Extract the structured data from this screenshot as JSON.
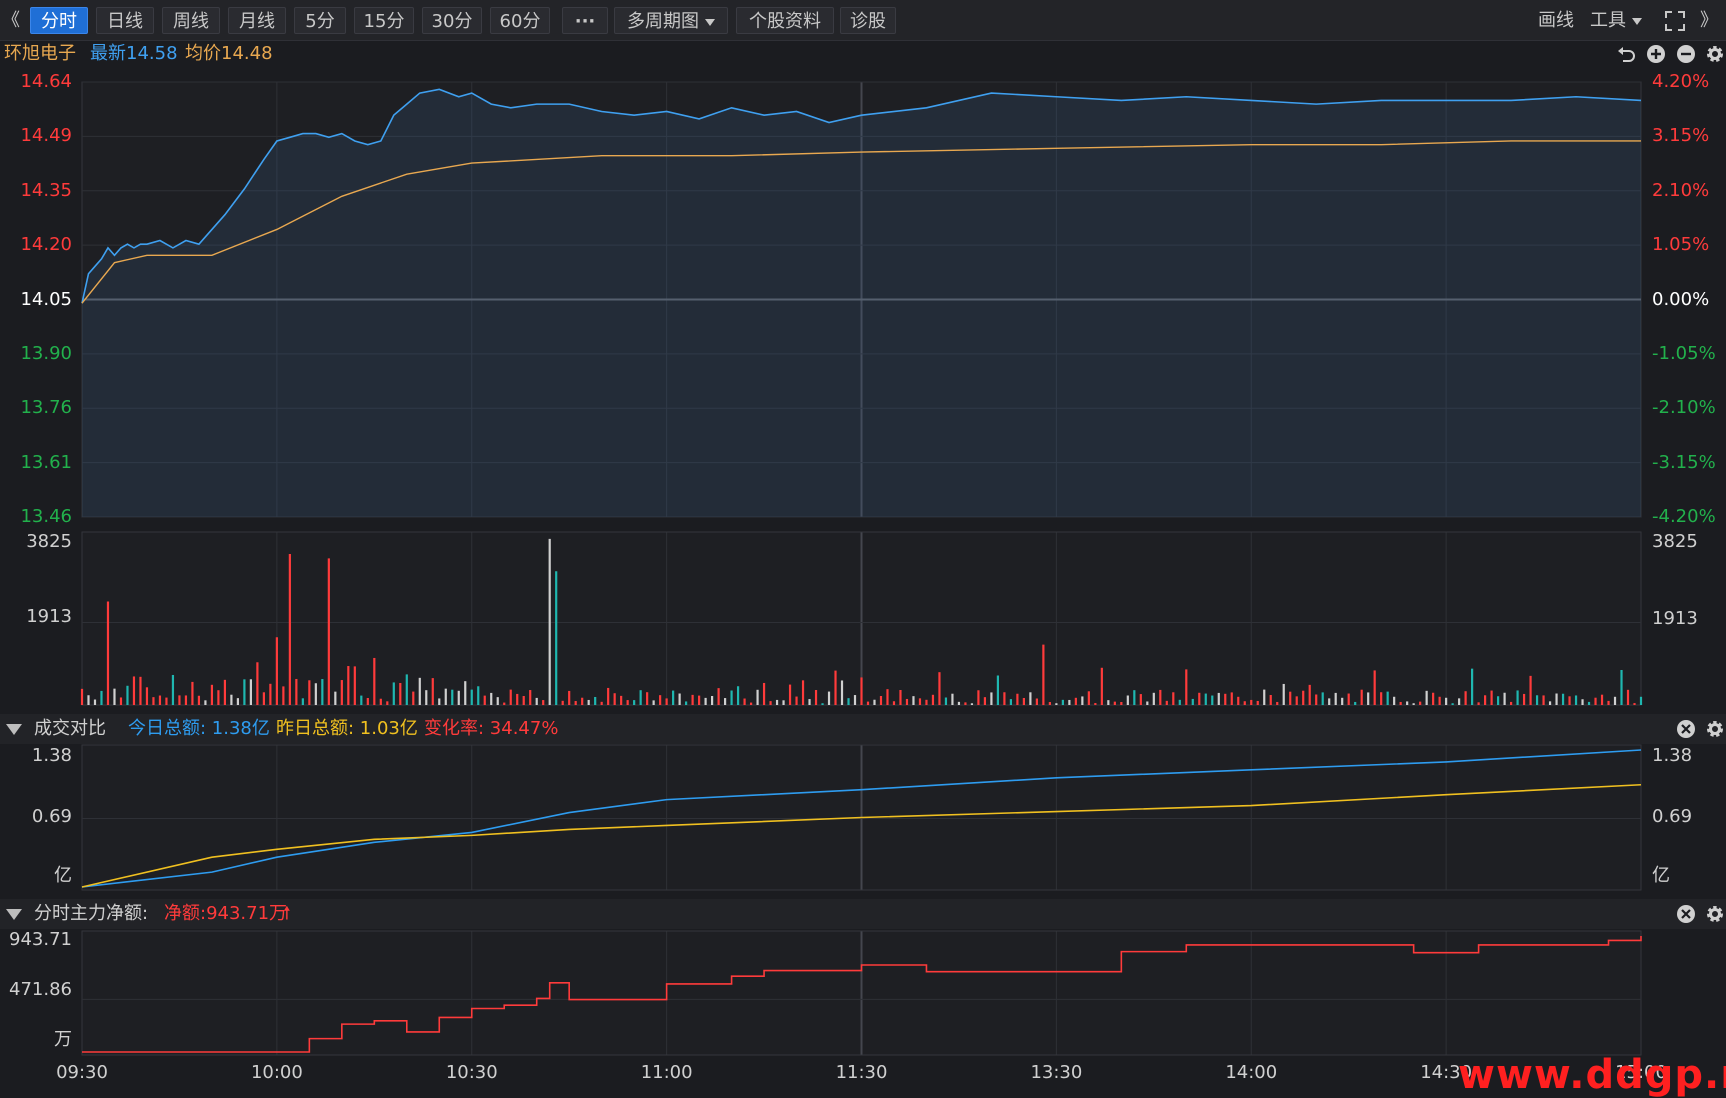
{
  "toolbar": {
    "nav_left": "《",
    "periods": [
      "分时",
      "日线",
      "周线",
      "月线",
      "5分",
      "15分",
      "30分",
      "60分"
    ],
    "more": "···",
    "multi": "多周期图",
    "profile": "个股资料",
    "diagnose": "诊股",
    "draw": "画线",
    "tools": "工具",
    "nav_right": "》"
  },
  "quote": {
    "name": "环旭电子",
    "latest": "最新14.58",
    "avg": "均价14.48"
  },
  "price_axis": {
    "left": [
      "14.64",
      "14.49",
      "14.35",
      "14.20",
      "14.05",
      "13.90",
      "13.76",
      "13.61",
      "13.46"
    ],
    "right": [
      "4.20%",
      "3.15%",
      "2.10%",
      "1.05%",
      "0.00%",
      "-1.05%",
      "-2.10%",
      "-3.15%",
      "-4.20%"
    ]
  },
  "volume_axis": {
    "left": [
      "3825",
      "1913"
    ],
    "right": [
      "3825",
      "1913"
    ]
  },
  "turnover_panel": {
    "title": "成交对比",
    "today": "今日总额: 1.38亿",
    "yesterday": "昨日总额: 1.03亿",
    "change": "变化率: 34.47%",
    "axis_left": [
      "1.38",
      "0.69",
      "亿"
    ],
    "axis_right": [
      "1.38",
      "0.69",
      "亿"
    ]
  },
  "netflow_panel": {
    "title": "分时主力净额:",
    "net": "净额:943.71万",
    "axis_left": [
      "943.71",
      "471.86",
      "万"
    ]
  },
  "time_axis": [
    "09:30",
    "10:00",
    "10:30",
    "11:00",
    "11:30",
    "13:30",
    "14:00",
    "14:30",
    "15:00"
  ],
  "watermark": "www.ddgp.net",
  "colors": {
    "price": "#3fa0f0",
    "avg": "#e8a850",
    "up": "#ff3b3b",
    "down": "#22b14c",
    "today": "#2e9cf0",
    "yesterday": "#f0c020",
    "net": "#ff3b3b"
  },
  "chart_data": [
    {
      "type": "line",
      "title": "",
      "series": [
        {
          "name": "最新",
          "x_minutes": [
            0,
            1,
            2,
            3,
            4,
            5,
            6,
            7,
            8,
            9,
            10,
            12,
            14,
            16,
            18,
            20,
            22,
            25,
            28,
            30,
            32,
            34,
            36,
            38,
            40,
            42,
            44,
            46,
            48,
            50,
            52,
            55,
            58,
            60,
            63,
            66,
            70,
            75,
            80,
            85,
            90,
            95,
            100,
            105,
            110,
            115,
            120,
            130,
            140,
            150,
            160,
            170,
            180,
            190,
            200,
            210,
            220,
            230,
            240
          ],
          "values": [
            14.04,
            14.12,
            14.14,
            14.16,
            14.19,
            14.17,
            14.19,
            14.2,
            14.19,
            14.2,
            14.2,
            14.21,
            14.19,
            14.21,
            14.2,
            14.24,
            14.28,
            14.35,
            14.43,
            14.48,
            14.49,
            14.5,
            14.5,
            14.49,
            14.5,
            14.48,
            14.47,
            14.48,
            14.55,
            14.58,
            14.61,
            14.62,
            14.6,
            14.61,
            14.58,
            14.57,
            14.58,
            14.58,
            14.56,
            14.55,
            14.56,
            14.54,
            14.57,
            14.55,
            14.56,
            14.53,
            14.55,
            14.57,
            14.61,
            14.6,
            14.59,
            14.6,
            14.59,
            14.58,
            14.59,
            14.59,
            14.59,
            14.6,
            14.59
          ]
        },
        {
          "name": "均价",
          "x_minutes": [
            0,
            5,
            10,
            20,
            30,
            40,
            50,
            60,
            80,
            100,
            120,
            150,
            180,
            200,
            220,
            240
          ],
          "values": [
            14.04,
            14.15,
            14.17,
            14.17,
            14.24,
            14.33,
            14.39,
            14.42,
            14.44,
            14.44,
            14.45,
            14.46,
            14.47,
            14.47,
            14.48,
            14.48
          ]
        }
      ],
      "ylim": [
        13.46,
        14.64
      ],
      "prev_close": 14.05
    },
    {
      "type": "bar",
      "title": "",
      "ylim": [
        0,
        3825
      ],
      "peaks": [
        {
          "minute": 4,
          "value": 2400
        },
        {
          "minute": 32,
          "value": 3500
        },
        {
          "minute": 38,
          "value": 3400
        },
        {
          "minute": 72,
          "value": 3850
        },
        {
          "minute": 73,
          "value": 3100
        },
        {
          "minute": 148,
          "value": 1400
        }
      ]
    },
    {
      "type": "line",
      "title": "",
      "series": [
        {
          "name": "今日总额",
          "x_minutes": [
            0,
            20,
            30,
            45,
            60,
            75,
            90,
            120,
            150,
            180,
            210,
            240
          ],
          "values": [
            0.0,
            0.15,
            0.3,
            0.45,
            0.55,
            0.75,
            0.88,
            0.98,
            1.1,
            1.18,
            1.26,
            1.38
          ]
        },
        {
          "name": "昨日总额",
          "x_minutes": [
            0,
            20,
            30,
            45,
            60,
            75,
            90,
            120,
            150,
            180,
            210,
            240
          ],
          "values": [
            0.0,
            0.3,
            0.38,
            0.48,
            0.52,
            0.58,
            0.62,
            0.7,
            0.76,
            0.82,
            0.93,
            1.03
          ]
        }
      ],
      "ylim": [
        0,
        1.38
      ]
    },
    {
      "type": "line",
      "title": "",
      "series": [
        {
          "name": "净额",
          "x_minutes": [
            0,
            30,
            35,
            40,
            45,
            50,
            55,
            60,
            65,
            70,
            72,
            75,
            85,
            90,
            100,
            105,
            120,
            130,
            150,
            160,
            170,
            200,
            205,
            210,
            215,
            220,
            235,
            240
          ],
          "values": [
            0,
            0,
            120,
            250,
            280,
            180,
            310,
            390,
            420,
            480,
            620,
            470,
            470,
            610,
            680,
            730,
            780,
            720,
            720,
            900,
            960,
            960,
            890,
            890,
            960,
            960,
            1000,
            1040
          ]
        }
      ],
      "ylim": [
        0,
        943.71
      ]
    }
  ]
}
